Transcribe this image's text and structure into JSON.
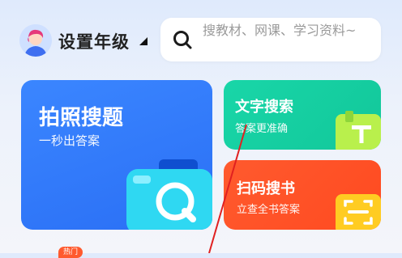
{
  "header": {
    "grade_label": "设置年级",
    "search_placeholder": "搜教材、网课、学习资料~"
  },
  "cards": {
    "photo": {
      "title": "拍照搜题",
      "subtitle": "一秒出答案"
    },
    "text": {
      "title": "文字搜索",
      "subtitle": "答案更准确"
    },
    "scan": {
      "title": "扫码搜书",
      "subtitle": "立查全书答案"
    }
  },
  "badge": {
    "label": "热门"
  },
  "colors": {
    "photo_card": "#2f7bff",
    "text_card": "#17d1a2",
    "scan_card": "#ff5226",
    "search_icon": "#1b1b1b",
    "annotation_line": "#e02020"
  }
}
